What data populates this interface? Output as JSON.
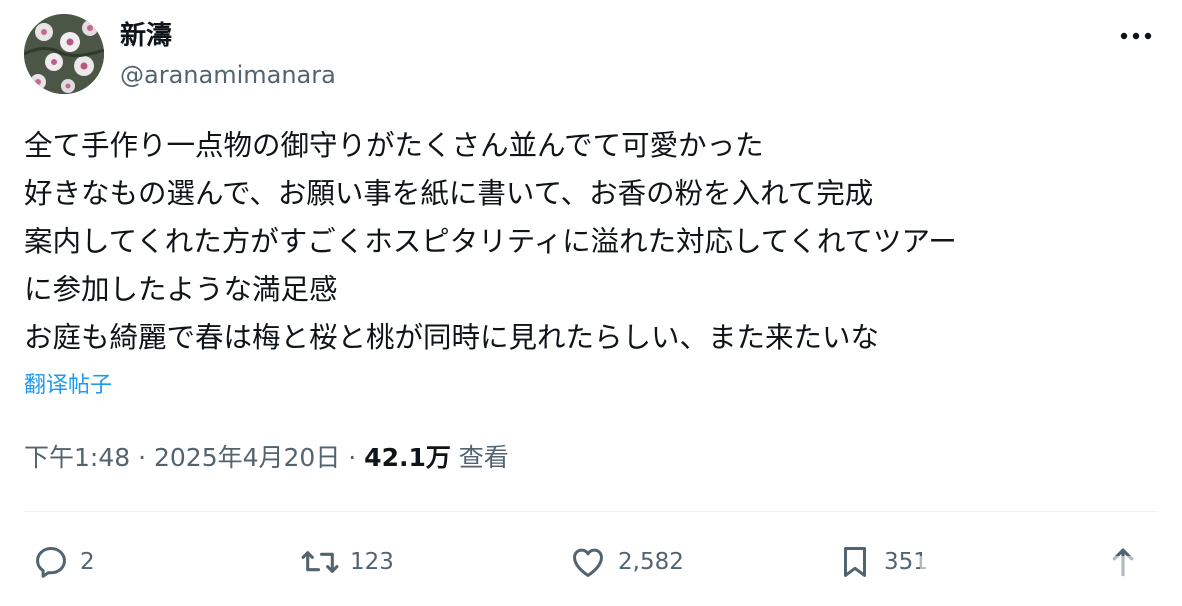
{
  "author": {
    "display_name": "新濤",
    "handle": "@aranamimanara"
  },
  "tweet": {
    "lines": [
      "全て手作り一点物の御守りがたくさん並んでて可愛かった",
      "好きなもの選んで、お願い事を紙に書いて、お香の粉を入れて完成",
      "案内してくれた方がすごくホスピタリティに溢れた対応してくれてツアー",
      "に参加したような満足感",
      "お庭も綺麗で春は梅と桜と桃が同時に見れたらしい、また来たいな"
    ],
    "translate_label": "翻译帖子"
  },
  "meta": {
    "time": "下午1:48",
    "sep1": " · ",
    "date": "2025年4月20日",
    "sep2": " · ",
    "views_count": "42.1万",
    "views_label": " 查看"
  },
  "actions": {
    "replies": "2",
    "reposts": "123",
    "likes": "2,582",
    "bookmarks": "351"
  },
  "icons": {
    "more": "more-horizontal-icon",
    "reply": "reply-icon",
    "repost": "repost-icon",
    "like": "heart-icon",
    "bookmark": "bookmark-icon",
    "share": "share-icon"
  },
  "colors": {
    "link": "#1d9bf0",
    "secondary": "#536471",
    "text": "#0f1419"
  }
}
